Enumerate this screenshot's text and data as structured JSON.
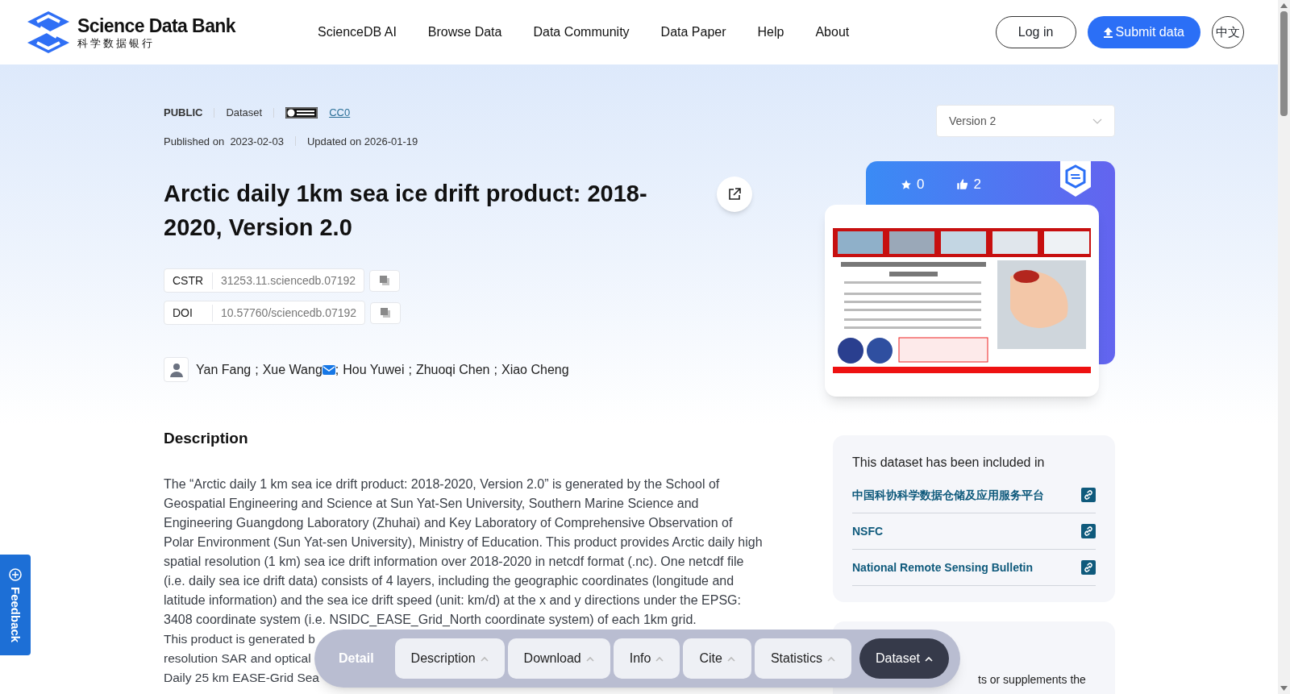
{
  "header": {
    "logo": {
      "title": "Science Data Bank",
      "subtitle": "科学数据银行"
    },
    "nav": [
      "ScienceDB AI",
      "Browse Data",
      "Data Community",
      "Data Paper",
      "Help",
      "About"
    ],
    "login": "Log in",
    "submit": "Submit data",
    "language": "中文"
  },
  "meta": {
    "access": "PUBLIC",
    "type": "Dataset",
    "license": "CC0",
    "published_label": "Published on",
    "published": "2023-02-03",
    "updated": "Updated on 2026-01-19"
  },
  "version_select": {
    "value": "Version 2"
  },
  "title": "Arctic daily 1km sea ice drift product: 2018-2020, Version 2.0",
  "identifiers": [
    {
      "label": "CSTR",
      "value": "31253.11.sciencedb.07192"
    },
    {
      "label": "DOI",
      "value": "10.57760/sciencedb.07192"
    }
  ],
  "authors": {
    "separator": ";",
    "list": [
      {
        "name": "Yan Fang",
        "email": false
      },
      {
        "name": "Xue Wang",
        "email": true
      },
      {
        "name": "Hou Yuwei",
        "email": false
      },
      {
        "name": "Zhuoqi Chen",
        "email": false
      },
      {
        "name": "Xiao Cheng",
        "email": false
      }
    ]
  },
  "stats": {
    "stars": "0",
    "likes": "2"
  },
  "description": {
    "heading": "Description",
    "paragraph": "The “Arctic daily 1 km sea ice drift product: 2018-2020, Version 2.0” is generated by the School of Geospatial Engineering and Science at Sun Yat-Sen University, Southern Marine Science and Engineering Guangdong Laboratory (Zhuhai) and Key Laboratory of Comprehensive Observation of Polar Environment (Sun Yat-sen University), Ministry of Education. This product provides Arctic daily high spatial resolution (1 km) sea ice drift information over 2018-2020 in netcdf format (.nc). One netcdf file (i.e. daily sea ice drift data) consists of 4 layers, including the geographic coordinates (longitude and latitude information) and the sea ice drift speed (unit: km/d) at the x and y directions under the EPSG: 3408 coordinate system (i.e. NSIDC_EASE_Grid_North coordinate system) of each 1km grid.",
    "partial_lines": [
      "This product is generated b",
      "resolution SAR and optical",
      "Daily 25 km EASE-Grid Sea"
    ]
  },
  "included": {
    "heading": "This dataset has been included in",
    "items": [
      "中国科协科学数据仓储及应用服务平台",
      "NSFC",
      "National Remote Sensing Bulletin"
    ]
  },
  "related_card": {
    "partial_text": "ts or supplements the"
  },
  "bottom_nav": {
    "label": "Detail",
    "items": [
      {
        "label": "Description",
        "selected": false
      },
      {
        "label": "Download",
        "selected": false
      },
      {
        "label": "Info",
        "selected": false
      },
      {
        "label": "Cite",
        "selected": false
      },
      {
        "label": "Statistics",
        "selected": false
      },
      {
        "label": "Dataset",
        "selected": true
      }
    ]
  },
  "feedback": "Feedback"
}
